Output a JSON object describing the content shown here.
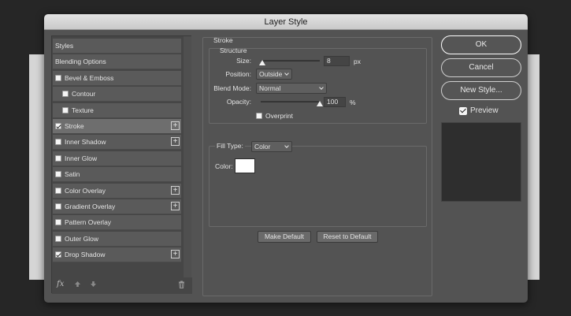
{
  "dialog": {
    "title": "Layer Style"
  },
  "styles": [
    {
      "label": "Styles",
      "type": "header"
    },
    {
      "label": "Blending Options",
      "type": "header"
    },
    {
      "label": "Bevel & Emboss",
      "type": "check",
      "checked": false,
      "indent": false,
      "plus": false
    },
    {
      "label": "Contour",
      "type": "check",
      "checked": false,
      "indent": true,
      "plus": false
    },
    {
      "label": "Texture",
      "type": "check",
      "checked": false,
      "indent": true,
      "plus": false
    },
    {
      "label": "Stroke",
      "type": "check",
      "checked": true,
      "indent": false,
      "plus": true,
      "selected": true
    },
    {
      "label": "Inner Shadow",
      "type": "check",
      "checked": false,
      "indent": false,
      "plus": true
    },
    {
      "label": "Inner Glow",
      "type": "check",
      "checked": false,
      "indent": false,
      "plus": false
    },
    {
      "label": "Satin",
      "type": "check",
      "checked": false,
      "indent": false,
      "plus": false
    },
    {
      "label": "Color Overlay",
      "type": "check",
      "checked": false,
      "indent": false,
      "plus": true
    },
    {
      "label": "Gradient Overlay",
      "type": "check",
      "checked": false,
      "indent": false,
      "plus": true
    },
    {
      "label": "Pattern Overlay",
      "type": "check",
      "checked": false,
      "indent": false,
      "plus": false
    },
    {
      "label": "Outer Glow",
      "type": "check",
      "checked": false,
      "indent": false,
      "plus": false
    },
    {
      "label": "Drop Shadow",
      "type": "check",
      "checked": true,
      "indent": false,
      "plus": true
    }
  ],
  "footer": {
    "fx_label": "fx",
    "plus_glyph": "+"
  },
  "stroke": {
    "title": "Stroke",
    "structure_title": "Structure",
    "size_label": "Size:",
    "size_value": "8",
    "size_unit": "px",
    "position_label": "Position:",
    "position_value": "Outside",
    "blend_label": "Blend Mode:",
    "blend_value": "Normal",
    "opacity_label": "Opacity:",
    "opacity_value": "100",
    "opacity_unit": "%",
    "overprint_label": "Overprint",
    "filltype_label": "Fill Type:",
    "filltype_value": "Color",
    "color_label": "Color:",
    "color_value": "#ffffff",
    "make_default": "Make Default",
    "reset_default": "Reset to Default"
  },
  "actions": {
    "ok": "OK",
    "cancel": "Cancel",
    "new_style": "New Style...",
    "preview": "Preview"
  }
}
